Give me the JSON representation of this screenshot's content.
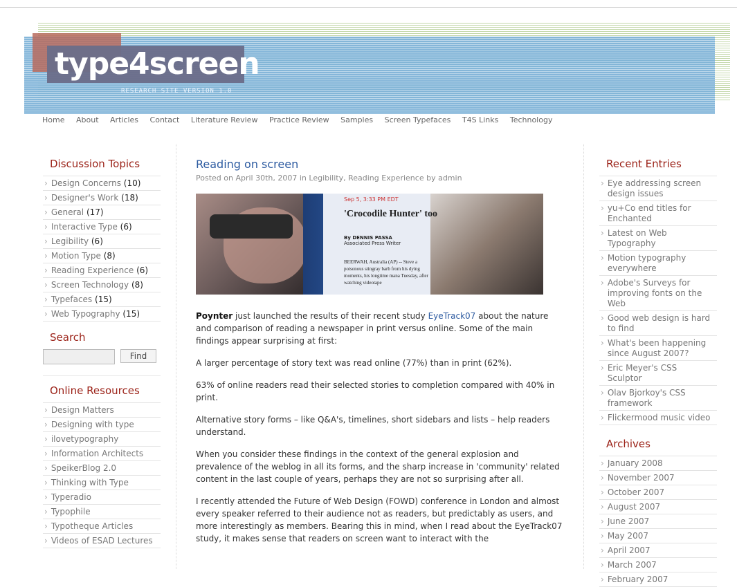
{
  "site": {
    "logo": "type4screen",
    "subtitle": "RESEARCH SITE VERSION 1.0"
  },
  "nav": [
    "Home",
    "About",
    "Articles",
    "Contact",
    "Literature Review",
    "Practice Review",
    "Samples",
    "Screen Typefaces",
    "T4S Links",
    "Technology"
  ],
  "left": {
    "topics_heading": "Discussion Topics",
    "topics": [
      {
        "label": "Design Concerns",
        "count": "(10)"
      },
      {
        "label": "Designer's Work",
        "count": "(18)"
      },
      {
        "label": "General",
        "count": "(17)"
      },
      {
        "label": "Interactive Type",
        "count": "(6)"
      },
      {
        "label": "Legibility",
        "count": "(6)"
      },
      {
        "label": "Motion Type",
        "count": "(8)"
      },
      {
        "label": "Reading Experience",
        "count": "(6)"
      },
      {
        "label": "Screen Technology",
        "count": "(8)"
      },
      {
        "label": "Typefaces",
        "count": "(15)"
      },
      {
        "label": "Web Typography",
        "count": "(15)"
      }
    ],
    "search_heading": "Search",
    "find_label": "Find",
    "resources_heading": "Online Resources",
    "resources": [
      "Design Matters",
      "Designing with type",
      "ilovetypography",
      "Information Architects",
      "SpeikerBlog 2.0",
      "Thinking with Type",
      "Typeradio",
      "Typophile",
      "Typotheque Articles",
      "Videos of ESAD Lectures"
    ]
  },
  "article": {
    "title": "Reading on screen",
    "byline": "Posted on April 30th, 2007 in Legibility, Reading Experience by admin",
    "image": {
      "time": "Sep 5, 3:33 PM EDT",
      "headline": "'Crocodile Hunter' too",
      "byline": "By DENNIS PASSA",
      "byline2": "Associated Press Writer",
      "text": "BEERWAH, Australia (AP) -- Steve a poisonous stingray barb from his dying moments, his longtime mana Tuesday, after watching videotape"
    },
    "p1_strong": "Poynter",
    "p1_a": " just launched the results of their recent study ",
    "p1_link": "EyeTrack07",
    "p1_b": " about the nature and comparison of reading a newspaper in print versus online. Some of the main findings appear surprising at first:",
    "p2": "A larger percentage of story text was read online (77%) than in print (62%).",
    "p3": "63% of online readers read their selected stories to completion compared with 40% in print.",
    "p4": "Alternative story forms – like Q&A's, timelines, short sidebars and lists – help readers understand.",
    "p5": "When you consider these findings in the context of the general explosion and prevalence of the weblog in all its forms, and the sharp increase in 'community' related content in the last couple of years, perhaps they are not so surprising after all.",
    "p6": "I recently attended the Future of Web Design (FOWD) conference in London and almost every speaker referred to their audience not as readers, but predictably as users, and more interestingly as members. Bearing this in mind, when I read about the EyeTrack07 study, it makes sense that readers on screen want to interact with the"
  },
  "right": {
    "recent_heading": "Recent Entries",
    "recent": [
      "Eye addressing screen design issues",
      "yu+Co end titles for Enchanted",
      "Latest on Web Typography",
      "Motion typography everywhere",
      "Adobe's Surveys for improving fonts on the Web",
      "Good web design is hard to find",
      "What's been happening since August 2007?",
      "Eric Meyer's CSS Sculptor",
      "Olav Bjorkoy's CSS framework",
      "Flickermood music video"
    ],
    "archives_heading": "Archives",
    "archives": [
      "January 2008",
      "November 2007",
      "October 2007",
      "August 2007",
      "June 2007",
      "May 2007",
      "April 2007",
      "March 2007",
      "February 2007"
    ]
  }
}
